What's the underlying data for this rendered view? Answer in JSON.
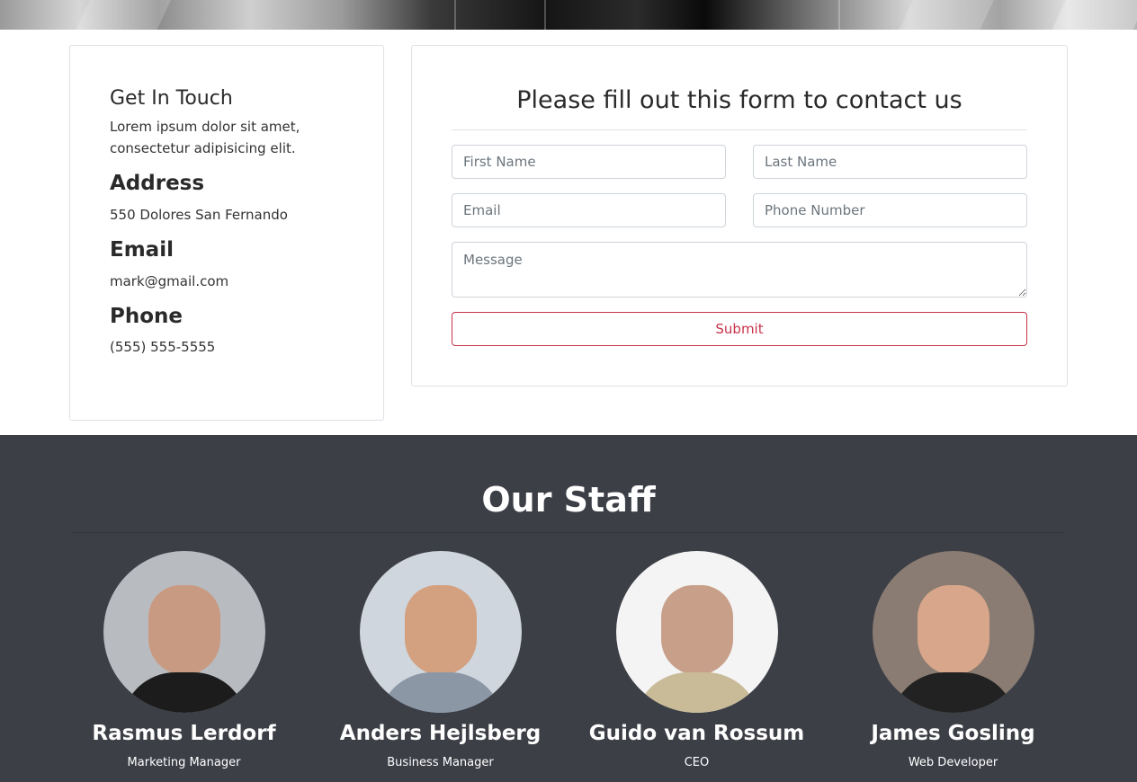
{
  "touch": {
    "heading": "Get In Touch",
    "intro": "Lorem ipsum dolor sit amet, consectetur adipisicing elit.",
    "address_heading": "Address",
    "address": "550 Dolores San Fernando",
    "email_heading": "Email",
    "email": "mark@gmail.com",
    "phone_heading": "Phone",
    "phone": "(555) 555-5555"
  },
  "form": {
    "title": "Please fill out this form to contact us",
    "first_name_placeholder": "First Name",
    "last_name_placeholder": "Last Name",
    "email_placeholder": "Email",
    "phone_placeholder": "Phone Number",
    "message_placeholder": "Message",
    "submit_label": "Submit",
    "accent_color": "#c8324a"
  },
  "staff": {
    "title": "Our Staff",
    "members": [
      {
        "name": "Rasmus Lerdorf",
        "role": "Marketing Manager"
      },
      {
        "name": "Anders Hejlsberg",
        "role": "Business Manager"
      },
      {
        "name": "Guido van Rossum",
        "role": "CEO"
      },
      {
        "name": "James Gosling",
        "role": "Web Developer"
      }
    ],
    "background_color": "#3d3f47"
  }
}
